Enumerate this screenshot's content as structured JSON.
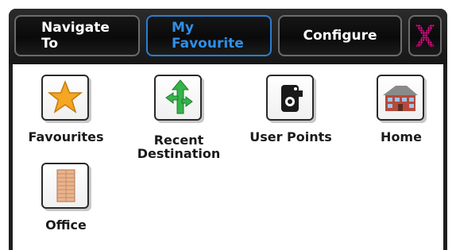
{
  "header": {
    "tabs": [
      {
        "label": "Navigate\nTo"
      },
      {
        "label": "My\nFavourite",
        "active": true
      },
      {
        "label": "Configure"
      }
    ],
    "close_icon": "close-x-icon",
    "colors": {
      "active_tab": "#2f8fe8",
      "close_icon": "#d81b8a"
    }
  },
  "favourites": [
    {
      "label": "Favourites",
      "icon": "star-icon"
    },
    {
      "label": "Recent\nDestination",
      "icon": "green-arrows-icon"
    },
    {
      "label": "User Points",
      "icon": "camera-icon"
    },
    {
      "label": "Home",
      "icon": "house-icon"
    },
    {
      "label": "Office",
      "icon": "office-building-icon"
    }
  ]
}
